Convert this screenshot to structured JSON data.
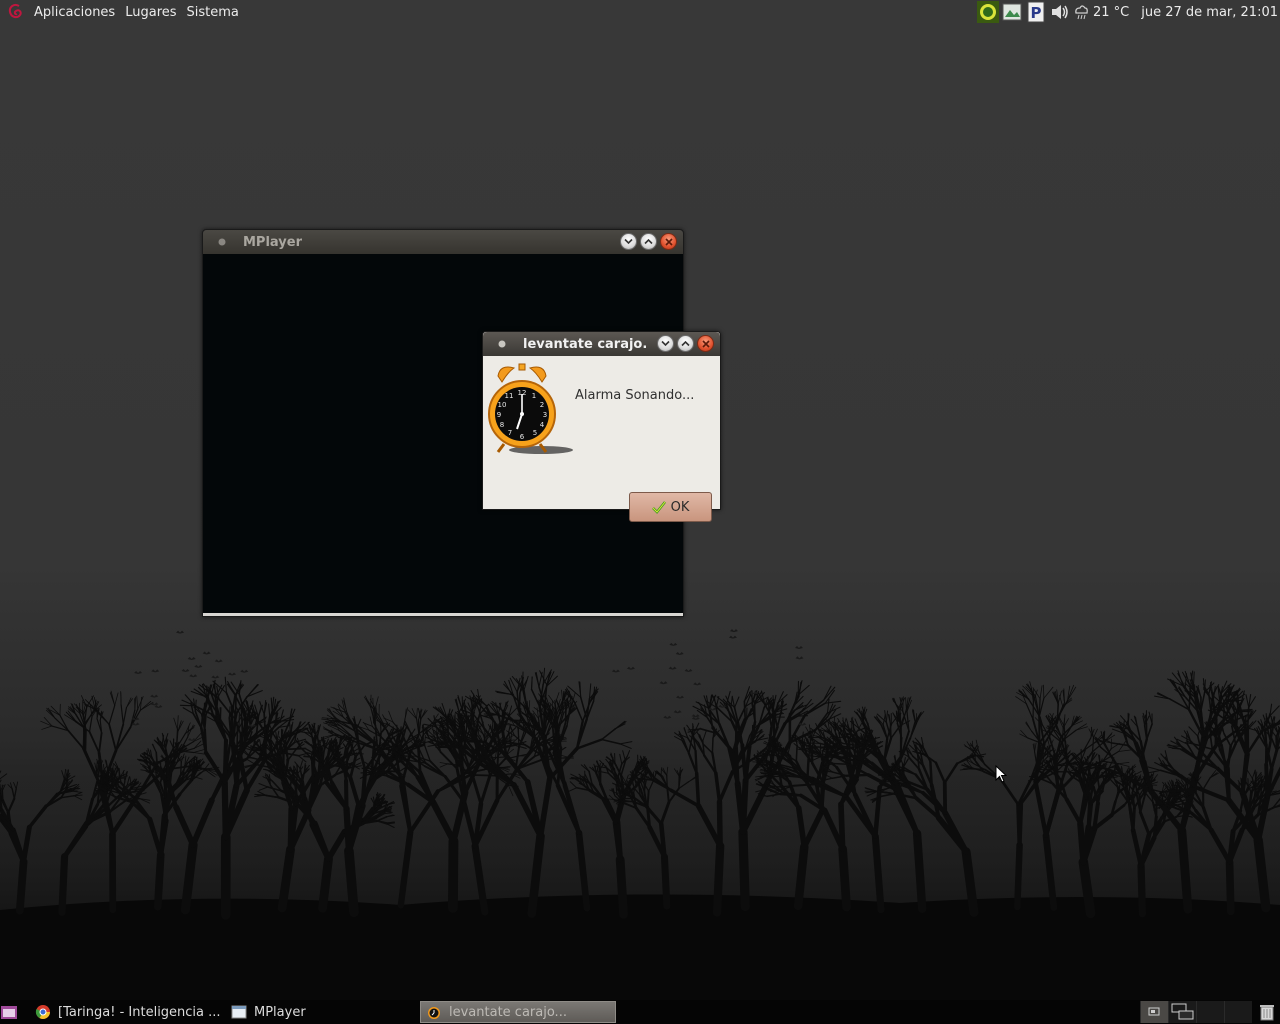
{
  "top_panel": {
    "menus": [
      "Aplicaciones",
      "Lugares",
      "Sistema"
    ],
    "weather": "21 °C",
    "clock": "jue 27 de mar, 21:01"
  },
  "windows": {
    "mplayer": {
      "title": "MPlayer"
    },
    "alarm": {
      "title": "levantate carajo.",
      "message": "Alarma Sonando...",
      "ok_label": "OK"
    }
  },
  "taskbar": {
    "tasks": [
      {
        "label": "[Taringa! - Inteligencia ...",
        "icon": "chrome-icon"
      },
      {
        "label": "MPlayer",
        "icon": "window-icon"
      },
      {
        "label": "levantate carajo...",
        "icon": "alarm-clock-icon",
        "active": true
      }
    ]
  },
  "colors": {
    "desktop": "#383838",
    "close_button": "#e0512e",
    "ok_button": "#c9957e"
  }
}
